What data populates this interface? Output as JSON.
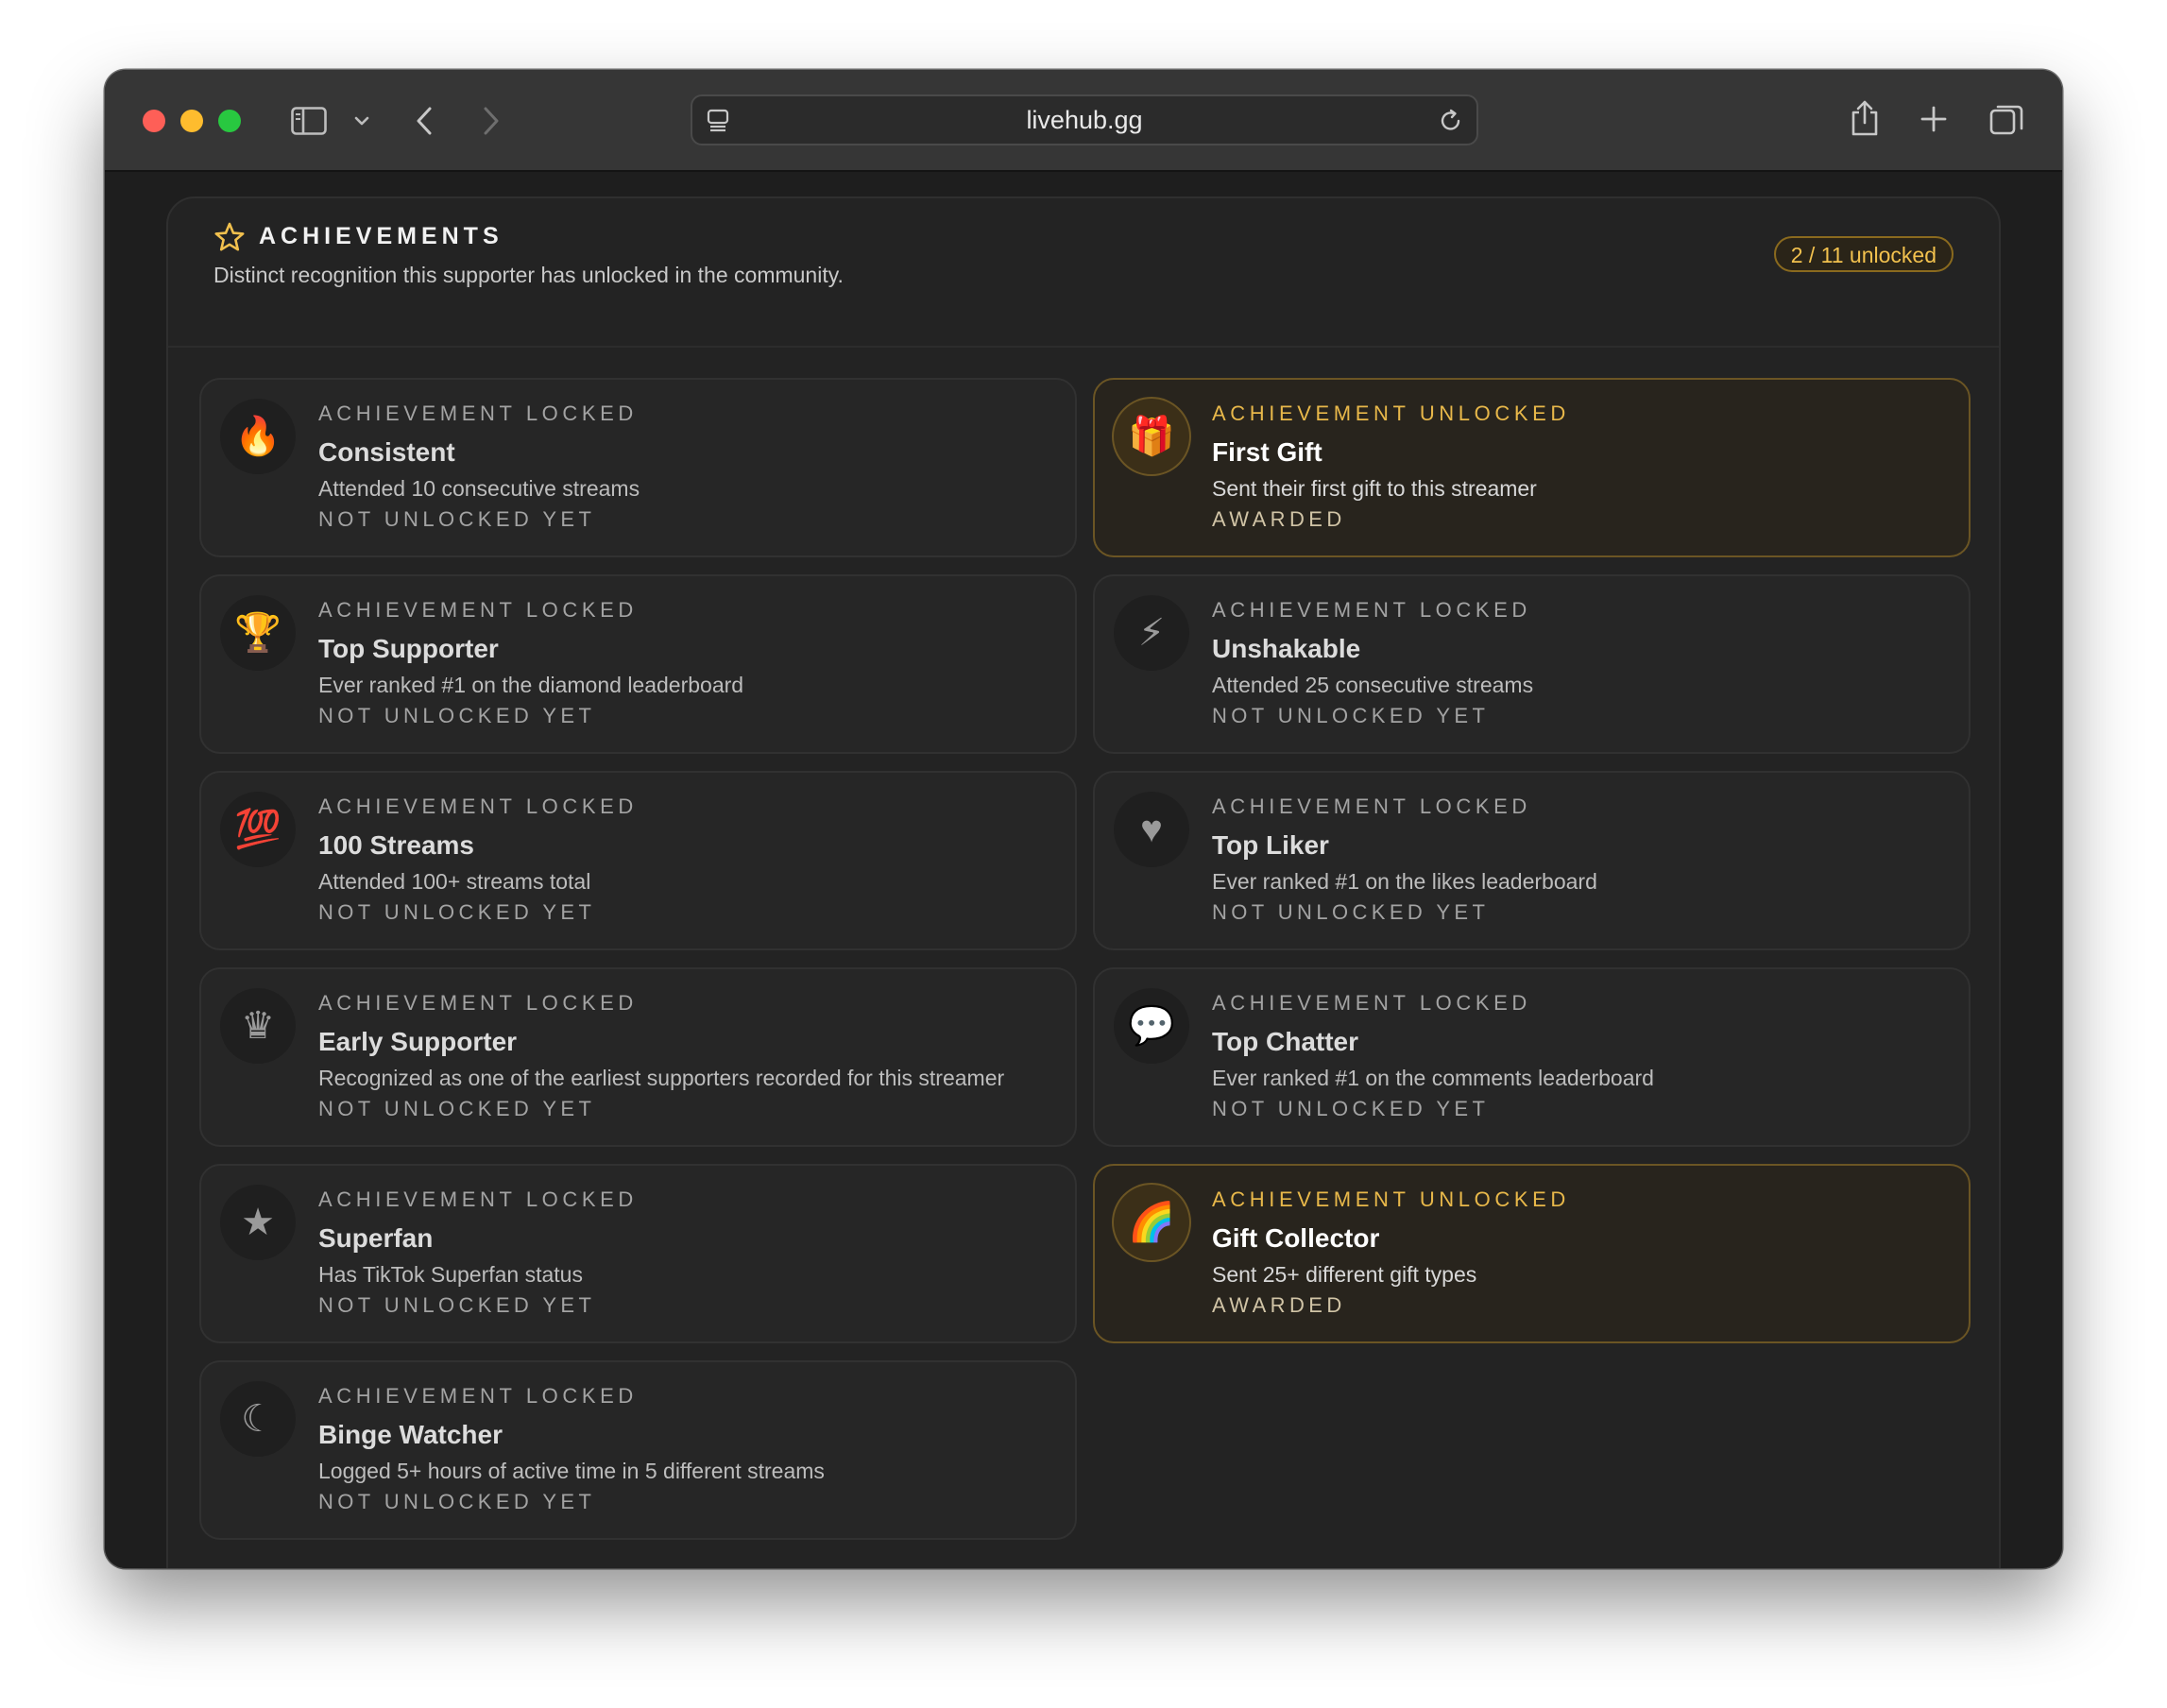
{
  "browser": {
    "url": "livehub.gg",
    "icons": [
      "sidebar-toggle-icon",
      "chevron-down-icon",
      "back-arrow-icon",
      "forward-arrow-icon",
      "page-settings-icon",
      "reload-icon",
      "share-icon",
      "new-tab-plus-icon",
      "tab-overview-icon"
    ]
  },
  "panel": {
    "title": "ACHIEVEMENTS",
    "subtitle": "Distinct recognition this supporter has unlocked in the community.",
    "unlocked_count": "2 / 11 unlocked",
    "accent_color": "#f2c14e"
  },
  "achievements": [
    {
      "eyebrow": "ACHIEVEMENT LOCKED",
      "title": "Consistent",
      "desc": "Attended 10 consecutive streams",
      "status": "NOT UNLOCKED YET",
      "icon": "🔥",
      "icon_name": "fire-icon",
      "unlocked": false
    },
    {
      "eyebrow": "ACHIEVEMENT UNLOCKED",
      "title": "First Gift",
      "desc": "Sent their first gift to this streamer",
      "status": "AWARDED",
      "icon": "🎁",
      "icon_name": "gift-icon",
      "unlocked": true
    },
    {
      "eyebrow": "ACHIEVEMENT LOCKED",
      "title": "Top Supporter",
      "desc": "Ever ranked #1 on the diamond leaderboard",
      "status": "NOT UNLOCKED YET",
      "icon": "🏆",
      "icon_name": "trophy-icon",
      "unlocked": false
    },
    {
      "eyebrow": "ACHIEVEMENT LOCKED",
      "title": "Unshakable",
      "desc": "Attended 25 consecutive streams",
      "status": "NOT UNLOCKED YET",
      "icon": "⚡",
      "icon_name": "lightning-icon",
      "unlocked": false
    },
    {
      "eyebrow": "ACHIEVEMENT LOCKED",
      "title": "100 Streams",
      "desc": "Attended 100+ streams total",
      "status": "NOT UNLOCKED YET",
      "icon": "💯",
      "icon_name": "hundred-points-icon",
      "unlocked": false
    },
    {
      "eyebrow": "ACHIEVEMENT LOCKED",
      "title": "Top Liker",
      "desc": "Ever ranked #1 on the likes leaderboard",
      "status": "NOT UNLOCKED YET",
      "icon": "♥",
      "icon_name": "heart-icon",
      "unlocked": false
    },
    {
      "eyebrow": "ACHIEVEMENT LOCKED",
      "title": "Early Supporter",
      "desc": "Recognized as one of the earliest supporters recorded for this streamer",
      "status": "NOT UNLOCKED YET",
      "icon": "♛",
      "icon_name": "crown-icon",
      "unlocked": false
    },
    {
      "eyebrow": "ACHIEVEMENT LOCKED",
      "title": "Top Chatter",
      "desc": "Ever ranked #1 on the comments leaderboard",
      "status": "NOT UNLOCKED YET",
      "icon": "💬",
      "icon_name": "speech-bubble-icon",
      "unlocked": false
    },
    {
      "eyebrow": "ACHIEVEMENT LOCKED",
      "title": "Superfan",
      "desc": "Has TikTok Superfan status",
      "status": "NOT UNLOCKED YET",
      "icon": "★",
      "icon_name": "star-icon",
      "unlocked": false
    },
    {
      "eyebrow": "ACHIEVEMENT UNLOCKED",
      "title": "Gift Collector",
      "desc": "Sent 25+ different gift types",
      "status": "AWARDED",
      "icon": "🌈",
      "icon_name": "rainbow-icon",
      "unlocked": true
    },
    {
      "eyebrow": "ACHIEVEMENT LOCKED",
      "title": "Binge Watcher",
      "desc": "Logged 5+ hours of active time in 5 different streams",
      "status": "NOT UNLOCKED YET",
      "icon": "☾",
      "icon_name": "crescent-moon-icon",
      "unlocked": false
    }
  ]
}
